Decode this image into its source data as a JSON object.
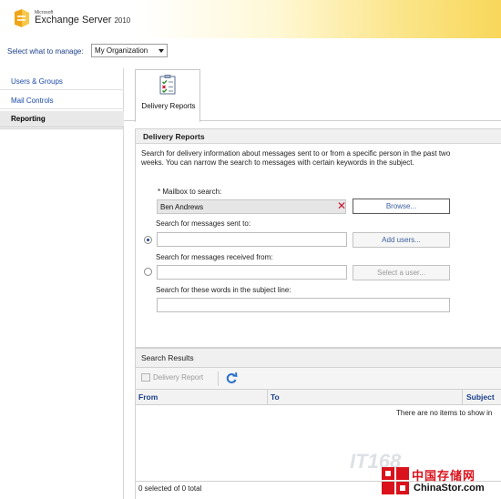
{
  "header": {
    "vendor": "Microsoft",
    "product": "Exchange Server",
    "version": "2010"
  },
  "manage": {
    "label": "Select what to manage:",
    "selected": "My Organization"
  },
  "sidebar": {
    "items": [
      {
        "label": "Users & Groups"
      },
      {
        "label": "Mail Controls"
      },
      {
        "label": "Reporting"
      }
    ]
  },
  "tabs": [
    {
      "label": "Delivery Reports"
    }
  ],
  "delivery": {
    "title": "Delivery Reports",
    "description": "Search for delivery information about messages sent to or from a specific person in the past two weeks. You can narrow the search to messages with certain keywords in the subject.",
    "mailbox_label": "* Mailbox to search:",
    "mailbox_value": "Ben Andrews",
    "browse_label": "Browse...",
    "sent_to_label": "Search for messages sent to:",
    "sent_to_value": "",
    "add_users_label": "Add users...",
    "received_from_label": "Search for messages received from:",
    "received_from_value": "",
    "select_user_label": "Select a user...",
    "subject_label": "Search for these words in the subject line:",
    "subject_value": ""
  },
  "results": {
    "title": "Search Results",
    "toolbar_delivery_report": "Delivery Report",
    "columns": [
      "From",
      "To",
      "Subject"
    ],
    "empty_text": "There are no items to show in",
    "status": "0 selected of 0 total"
  },
  "watermark": {
    "brand": "中国存储网",
    "site": "ChinaStor.com",
    "faint_text": "IT168"
  },
  "icons": {
    "logo": "exchange-logo-icon",
    "tab": "delivery-reports-icon",
    "clear": "clear-x-icon",
    "refresh": "refresh-icon"
  },
  "colors": {
    "link": "#1c4aa8",
    "accent_band": "#f8d75a",
    "error_x": "#c8102e",
    "watermark_red": "#d9121b"
  }
}
